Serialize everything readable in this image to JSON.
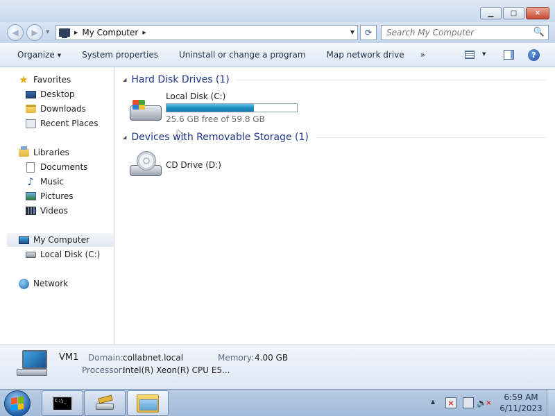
{
  "window": {
    "minimize_glyph": "▁",
    "maximize_glyph": "□",
    "close_glyph": "✕"
  },
  "nav": {
    "back_glyph": "◀",
    "forward_glyph": "▶",
    "address_path": "My Computer",
    "refresh_glyph": "⟳",
    "search_placeholder": "Search My Computer",
    "search_icon": "🔍"
  },
  "commands": {
    "organize": "Organize",
    "system_properties": "System properties",
    "uninstall": "Uninstall or change a program",
    "map_drive": "Map network drive",
    "more": "»",
    "help": "?"
  },
  "sidebar": {
    "favorites": "Favorites",
    "desktop": "Desktop",
    "downloads": "Downloads",
    "recent_places": "Recent Places",
    "libraries": "Libraries",
    "documents": "Documents",
    "music": "Music",
    "pictures": "Pictures",
    "videos": "Videos",
    "my_computer": "My Computer",
    "local_disk": "Local Disk (C:)",
    "network": "Network"
  },
  "content": {
    "hdd_group": "Hard Disk Drives (1)",
    "removable_group": "Devices with Removable Storage (1)",
    "local_disk": {
      "name": "Local Disk (C:)",
      "free_text": "25.6 GB free of 59.8 GB",
      "used_fraction": 0.67
    },
    "cd_drive": {
      "name": "CD Drive (D:)"
    }
  },
  "details": {
    "computer_name": "VM1",
    "domain_label": "Domain:",
    "domain_value": "collabnet.local",
    "memory_label": "Memory:",
    "memory_value": "4.00 GB",
    "processor_label": "Processor:",
    "processor_value": "Intel(R) Xeon(R) CPU E5..."
  },
  "taskbar": {
    "cmd_text": "C:\\_",
    "time": "6:59 AM",
    "date": "6/11/2023",
    "tray_up": "▲"
  }
}
